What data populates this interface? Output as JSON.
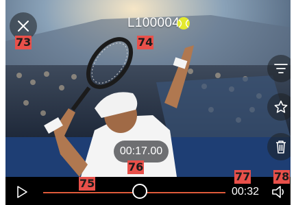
{
  "viewer": {
    "title": "L1000042",
    "current_time": "00:17.00",
    "duration": "00:32",
    "progress_fraction": 0.53
  },
  "markers": {
    "close": "73",
    "title": "74",
    "progress": "75",
    "current_time": "76",
    "duration": "77",
    "volume": "78"
  },
  "icons": {
    "close": "close-icon",
    "filter": "filter-icon",
    "favorite": "star-icon",
    "delete": "trash-icon",
    "play": "play-icon",
    "volume": "volume-icon"
  },
  "colors": {
    "marker": "#e8504a",
    "progress": "#e05a3a",
    "control_bar": "#000000"
  }
}
